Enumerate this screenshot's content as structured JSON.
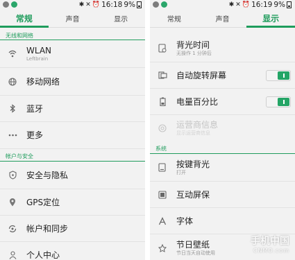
{
  "left": {
    "status": {
      "time": "16:18",
      "battery": "9%"
    },
    "tabs": [
      "常规",
      "声音",
      "显示"
    ],
    "section1": "无线和网络",
    "rows1": [
      {
        "title": "WLAN",
        "sub": "Leftbrain",
        "icon": "wifi-icon"
      },
      {
        "title": "移动网络",
        "icon": "globe-icon"
      },
      {
        "title": "蓝牙",
        "icon": "bluetooth-icon"
      },
      {
        "title": "更多",
        "icon": "more-dots-icon"
      }
    ],
    "section2": "帐户与安全",
    "rows2": [
      {
        "title": "安全与隐私",
        "icon": "shield-icon"
      },
      {
        "title": "GPS定位",
        "icon": "location-pin-icon"
      },
      {
        "title": "帐户和同步",
        "icon": "sync-icon"
      },
      {
        "title": "个人中心",
        "icon": "person-icon"
      }
    ]
  },
  "right": {
    "status": {
      "time": "16:19",
      "battery": "9%"
    },
    "tabs": [
      "常规",
      "声音",
      "显示"
    ],
    "rows1": [
      {
        "title": "背光时间",
        "sub": "无操作 1 分钟后",
        "icon": "backlight-timer-icon"
      },
      {
        "title": "自动旋转屏幕",
        "icon": "rotate-screen-icon",
        "toggle": true
      },
      {
        "title": "电量百分比",
        "icon": "battery-icon",
        "toggle": true
      },
      {
        "title": "运营商信息",
        "sub": "显示运营商信息",
        "icon": "carrier-info-icon",
        "disabled": true
      }
    ],
    "section": "系统",
    "rows2": [
      {
        "title": "按键背光",
        "sub": "打开",
        "icon": "key-backlight-icon"
      },
      {
        "title": "互动屏保",
        "icon": "screensaver-icon"
      },
      {
        "title": "字体",
        "icon": "font-icon"
      },
      {
        "title": "节日壁纸",
        "sub": "节日当天自动使用",
        "icon": "holiday-wallpaper-icon"
      }
    ]
  },
  "watermark": {
    "main": "手机中国",
    "sub": "CNMO.com"
  },
  "colors": {
    "accent": "#1f9c5c",
    "toggle_on": "#24a566",
    "background": "#f2f2f2"
  }
}
